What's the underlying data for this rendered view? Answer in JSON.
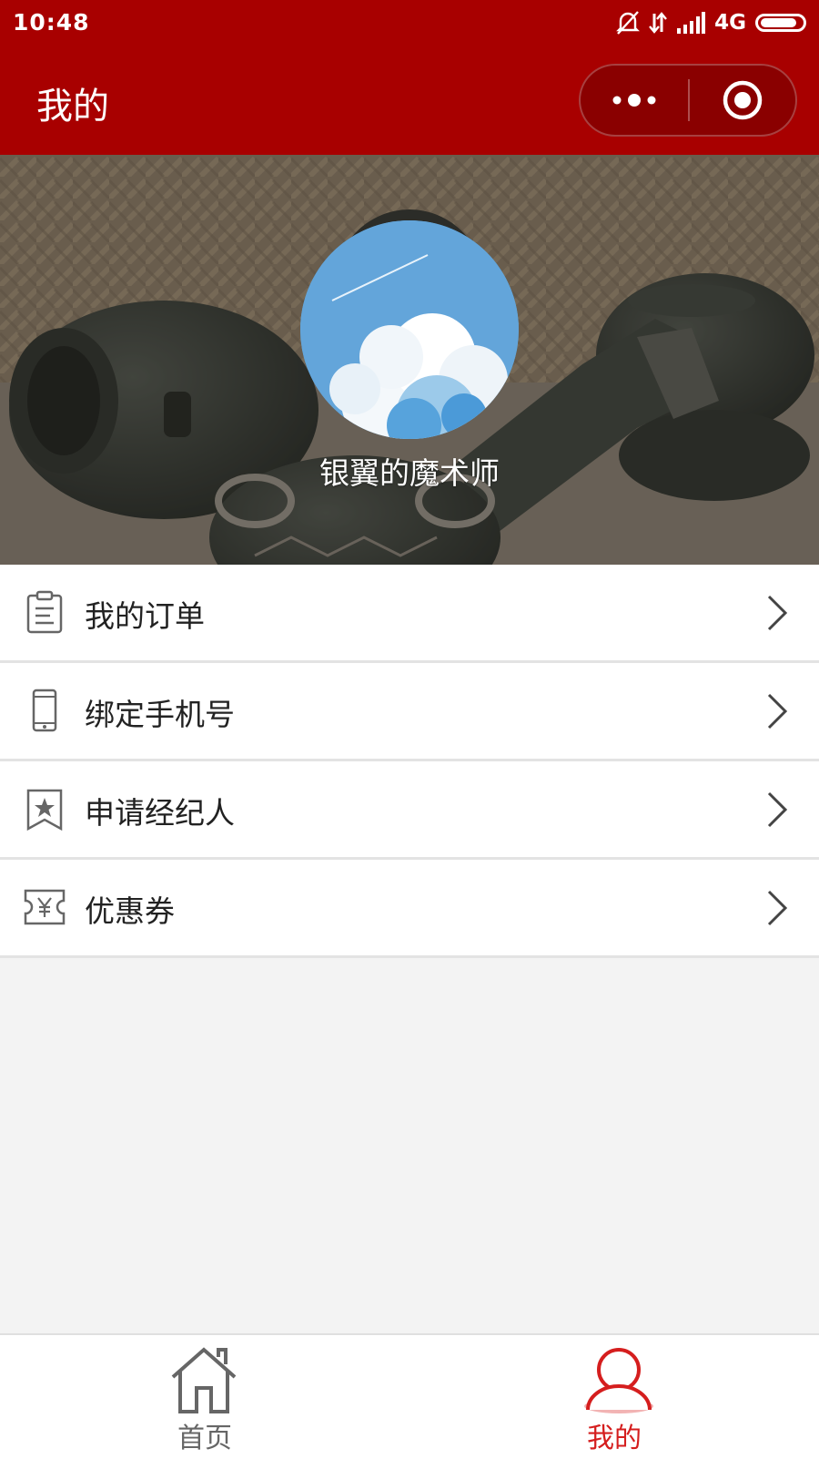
{
  "status_bar": {
    "time": "10:48",
    "network": "4G",
    "icons": [
      "mute-bell-icon",
      "data-arrows-icon",
      "signal-bars-icon",
      "battery-icon"
    ]
  },
  "nav": {
    "title": "我的",
    "capsule_icons": [
      "more-dots-icon",
      "close-target-icon"
    ]
  },
  "profile": {
    "username": "银翼的魔术师"
  },
  "menu": {
    "items": [
      {
        "label": "我的订单",
        "icon": "clipboard-icon"
      },
      {
        "label": "绑定手机号",
        "icon": "phone-icon"
      },
      {
        "label": "申请经纪人",
        "icon": "star-bookmark-icon"
      },
      {
        "label": "优惠券",
        "icon": "coupon-yen-icon"
      }
    ]
  },
  "tabbar": {
    "tabs": [
      {
        "label": "首页",
        "icon": "home-icon",
        "active": false
      },
      {
        "label": "我的",
        "icon": "user-icon",
        "active": true
      }
    ]
  },
  "colors": {
    "header": "#a80000",
    "active_tab": "#d51e1e",
    "inactive_tab": "#666666",
    "background": "#f3f3f3"
  }
}
